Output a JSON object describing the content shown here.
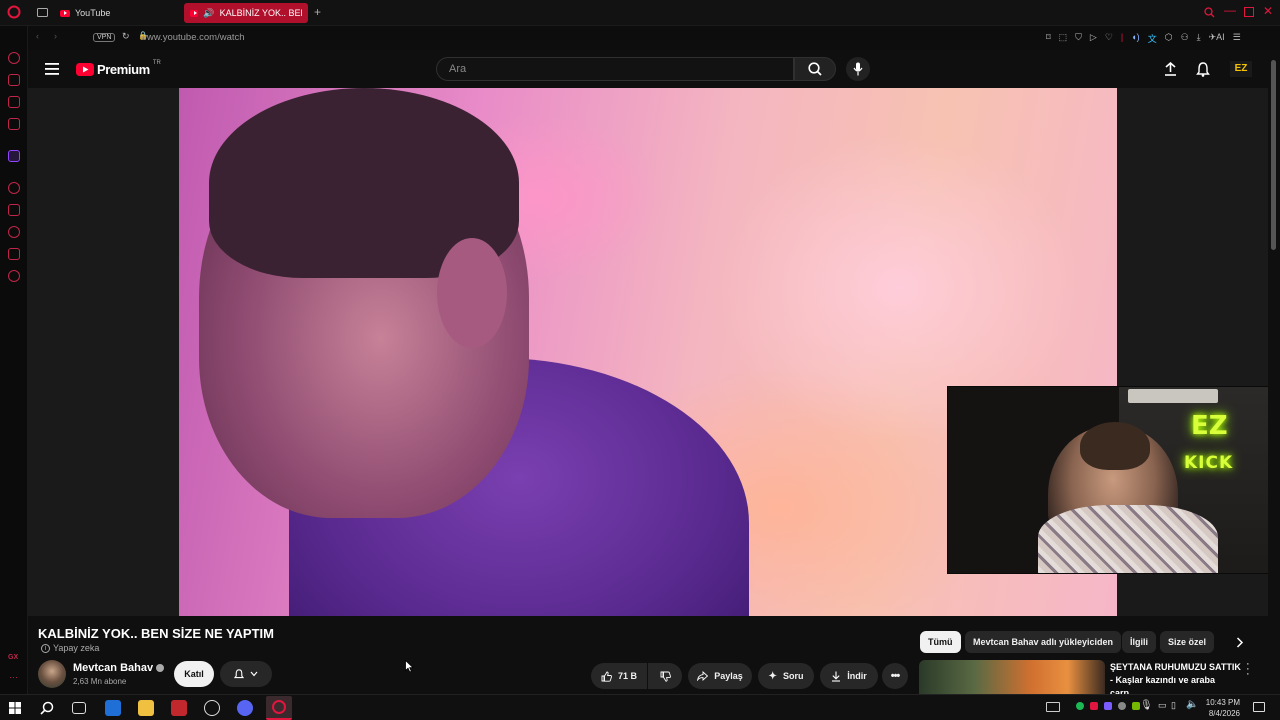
{
  "browser": {
    "tabs": [
      {
        "label": "YouTube"
      },
      {
        "label": "KALBİNİZ YOK.. BEN Sİ"
      }
    ],
    "vpn_label": "VPN",
    "url": "www.youtube.com/watch",
    "ai_label": "AI"
  },
  "yt_header": {
    "logo_text": "Premium",
    "logo_region": "TR",
    "search_placeholder": "Ara"
  },
  "webcam": {
    "neon_top": "EZ",
    "neon_bottom": "KICK"
  },
  "video": {
    "title": "KALBİNİZ YOK.. BEN SİZE NE YAPTIM",
    "ai_badge": "Yapay zeka",
    "channel_name": "Mevtcan Bahav",
    "subscribers": "2,63 Mn abone",
    "join_label": "Katıl",
    "like_count": "71 B",
    "share_label": "Paylaş",
    "ask_label": "Soru",
    "download_label": "İndir"
  },
  "chips": [
    {
      "label": "Tümü",
      "active": true
    },
    {
      "label": "Mevtcan Bahav adlı yükleyiciden",
      "active": false
    },
    {
      "label": "İlgili",
      "active": false
    },
    {
      "label": "Size özel",
      "active": false
    }
  ],
  "recommendation": {
    "title": "ŞEYTANA RUHUMUZU SATTIK - Kaşlar kazındı ve araba çarp..."
  },
  "sidebar": {
    "bottom_label": "GX"
  },
  "taskbar": {
    "time": "10:43 PM",
    "date": "8/4/2026"
  },
  "colors": {
    "accent": "#ff0033",
    "opera_red": "#b0102b",
    "neon": "#d8ff3a"
  }
}
